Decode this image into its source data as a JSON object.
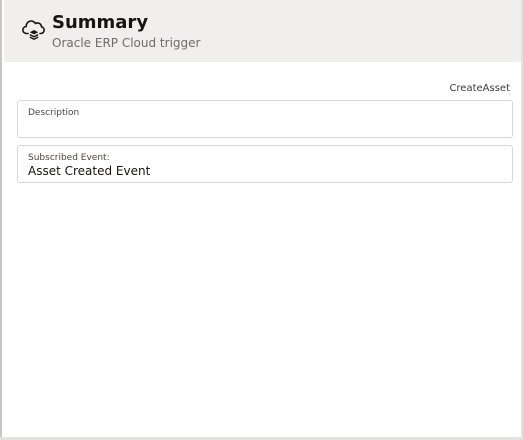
{
  "header": {
    "icon": "cloud-stack-icon",
    "title": "Summary",
    "subtitle": "Oracle ERP Cloud trigger"
  },
  "asset_code": "CreateAsset",
  "fields": {
    "description": {
      "label": "Description",
      "value": ""
    },
    "subscribed_event": {
      "label": "Subscribed Event:",
      "value": "Asset Created Event"
    }
  },
  "colors": {
    "header_background": "#f1efed",
    "title_text": "#161513",
    "subtitle_text": "#6f6b67",
    "field_border": "#dad8d5"
  }
}
